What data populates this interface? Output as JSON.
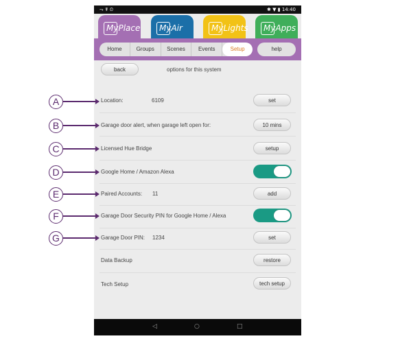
{
  "status_bar": {
    "left_icons": "⤳ ☤ ⏲",
    "right_icons": "✱ ▼ ▮",
    "time": "14:40"
  },
  "app_tabs": [
    {
      "my": "My",
      "name": "Place",
      "color": "#a46fb3"
    },
    {
      "my": "My",
      "name": "Air",
      "color": "#1b6fa8"
    },
    {
      "my": "My",
      "name": "Lights",
      "color": "#f2c216"
    },
    {
      "my": "My",
      "name": "Apps",
      "color": "#3fae5a"
    }
  ],
  "nav": {
    "tabs": [
      "Home",
      "Groups",
      "Scenes",
      "Events",
      "Setup"
    ],
    "active": "Setup",
    "help": "help"
  },
  "header": {
    "back": "back",
    "title": "options for this system"
  },
  "rows": [
    {
      "callout": "A",
      "label": "Location:",
      "value": "6109",
      "control": "button",
      "button": "set"
    },
    {
      "callout": "B",
      "label": "Garage door alert, when garage left open for:",
      "value": "",
      "control": "button",
      "button": "10 mins"
    },
    {
      "callout": "C",
      "label": "Licensed Hue Bridge",
      "value": "",
      "control": "button",
      "button": "setup"
    },
    {
      "callout": "D",
      "label": "Google Home / Amazon Alexa",
      "value": "",
      "control": "toggle",
      "on": true
    },
    {
      "callout": "E",
      "label": "Paired Accounts:",
      "value": "11",
      "control": "button",
      "button": "add"
    },
    {
      "callout": "F",
      "label": "Garage Door Security PIN for Google Home / Alexa",
      "value": "",
      "control": "toggle",
      "on": true
    },
    {
      "callout": "G",
      "label": "Garage Door PIN:",
      "value": "1234",
      "control": "button",
      "button": "set"
    },
    {
      "callout": "",
      "label": "Data Backup",
      "value": "",
      "control": "button",
      "button": "restore"
    },
    {
      "callout": "",
      "label": "Tech Setup",
      "value": "",
      "control": "button",
      "button": "tech setup"
    }
  ],
  "system_nav": {
    "back": "◁",
    "home": "○",
    "recents": "□"
  }
}
